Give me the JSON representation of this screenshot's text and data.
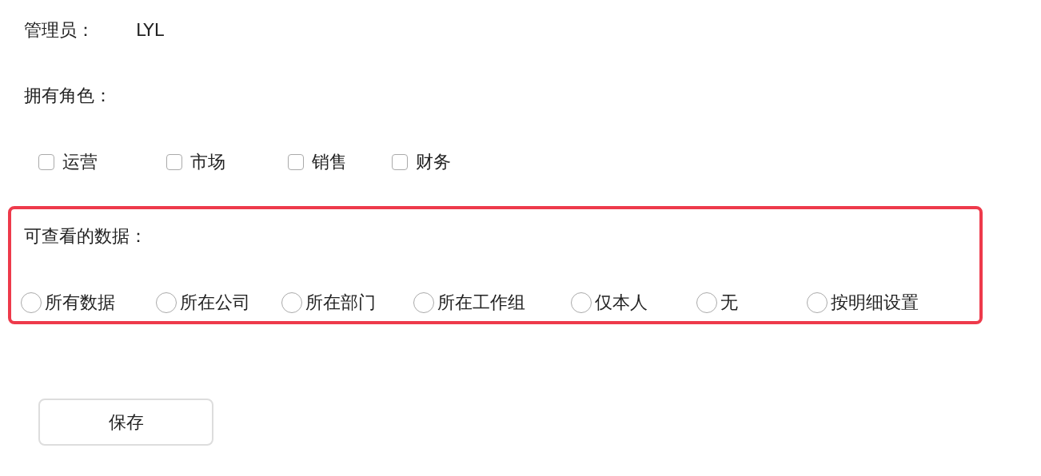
{
  "admin": {
    "label": "管理员：",
    "value": "LYL"
  },
  "roles": {
    "title": "拥有角色：",
    "items": [
      {
        "label": "运营",
        "checked": false
      },
      {
        "label": "市场",
        "checked": false
      },
      {
        "label": "销售",
        "checked": false
      },
      {
        "label": "财务",
        "checked": false
      }
    ]
  },
  "data_scope": {
    "title": "可查看的数据：",
    "options": [
      {
        "label": "所有数据",
        "selected": false
      },
      {
        "label": "所在公司",
        "selected": false
      },
      {
        "label": "所在部门",
        "selected": false
      },
      {
        "label": "所在工作组",
        "selected": false
      },
      {
        "label": "仅本人",
        "selected": false
      },
      {
        "label": "无",
        "selected": false
      },
      {
        "label": "按明细设置",
        "selected": false
      }
    ]
  },
  "save_button": "保存"
}
